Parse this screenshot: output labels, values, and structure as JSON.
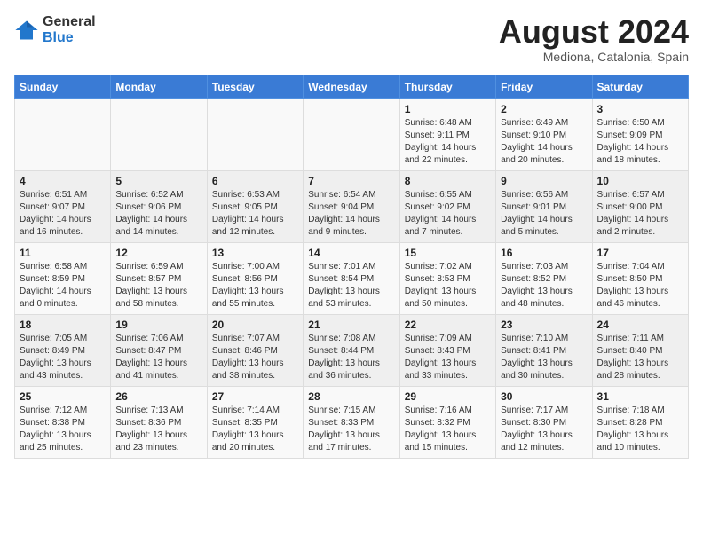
{
  "header": {
    "logo_general": "General",
    "logo_blue": "Blue",
    "month_year": "August 2024",
    "location": "Mediona, Catalonia, Spain"
  },
  "days_of_week": [
    "Sunday",
    "Monday",
    "Tuesday",
    "Wednesday",
    "Thursday",
    "Friday",
    "Saturday"
  ],
  "weeks": [
    [
      {
        "day": "",
        "info": ""
      },
      {
        "day": "",
        "info": ""
      },
      {
        "day": "",
        "info": ""
      },
      {
        "day": "",
        "info": ""
      },
      {
        "day": "1",
        "info": "Sunrise: 6:48 AM\nSunset: 9:11 PM\nDaylight: 14 hours\nand 22 minutes."
      },
      {
        "day": "2",
        "info": "Sunrise: 6:49 AM\nSunset: 9:10 PM\nDaylight: 14 hours\nand 20 minutes."
      },
      {
        "day": "3",
        "info": "Sunrise: 6:50 AM\nSunset: 9:09 PM\nDaylight: 14 hours\nand 18 minutes."
      }
    ],
    [
      {
        "day": "4",
        "info": "Sunrise: 6:51 AM\nSunset: 9:07 PM\nDaylight: 14 hours\nand 16 minutes."
      },
      {
        "day": "5",
        "info": "Sunrise: 6:52 AM\nSunset: 9:06 PM\nDaylight: 14 hours\nand 14 minutes."
      },
      {
        "day": "6",
        "info": "Sunrise: 6:53 AM\nSunset: 9:05 PM\nDaylight: 14 hours\nand 12 minutes."
      },
      {
        "day": "7",
        "info": "Sunrise: 6:54 AM\nSunset: 9:04 PM\nDaylight: 14 hours\nand 9 minutes."
      },
      {
        "day": "8",
        "info": "Sunrise: 6:55 AM\nSunset: 9:02 PM\nDaylight: 14 hours\nand 7 minutes."
      },
      {
        "day": "9",
        "info": "Sunrise: 6:56 AM\nSunset: 9:01 PM\nDaylight: 14 hours\nand 5 minutes."
      },
      {
        "day": "10",
        "info": "Sunrise: 6:57 AM\nSunset: 9:00 PM\nDaylight: 14 hours\nand 2 minutes."
      }
    ],
    [
      {
        "day": "11",
        "info": "Sunrise: 6:58 AM\nSunset: 8:59 PM\nDaylight: 14 hours\nand 0 minutes."
      },
      {
        "day": "12",
        "info": "Sunrise: 6:59 AM\nSunset: 8:57 PM\nDaylight: 13 hours\nand 58 minutes."
      },
      {
        "day": "13",
        "info": "Sunrise: 7:00 AM\nSunset: 8:56 PM\nDaylight: 13 hours\nand 55 minutes."
      },
      {
        "day": "14",
        "info": "Sunrise: 7:01 AM\nSunset: 8:54 PM\nDaylight: 13 hours\nand 53 minutes."
      },
      {
        "day": "15",
        "info": "Sunrise: 7:02 AM\nSunset: 8:53 PM\nDaylight: 13 hours\nand 50 minutes."
      },
      {
        "day": "16",
        "info": "Sunrise: 7:03 AM\nSunset: 8:52 PM\nDaylight: 13 hours\nand 48 minutes."
      },
      {
        "day": "17",
        "info": "Sunrise: 7:04 AM\nSunset: 8:50 PM\nDaylight: 13 hours\nand 46 minutes."
      }
    ],
    [
      {
        "day": "18",
        "info": "Sunrise: 7:05 AM\nSunset: 8:49 PM\nDaylight: 13 hours\nand 43 minutes."
      },
      {
        "day": "19",
        "info": "Sunrise: 7:06 AM\nSunset: 8:47 PM\nDaylight: 13 hours\nand 41 minutes."
      },
      {
        "day": "20",
        "info": "Sunrise: 7:07 AM\nSunset: 8:46 PM\nDaylight: 13 hours\nand 38 minutes."
      },
      {
        "day": "21",
        "info": "Sunrise: 7:08 AM\nSunset: 8:44 PM\nDaylight: 13 hours\nand 36 minutes."
      },
      {
        "day": "22",
        "info": "Sunrise: 7:09 AM\nSunset: 8:43 PM\nDaylight: 13 hours\nand 33 minutes."
      },
      {
        "day": "23",
        "info": "Sunrise: 7:10 AM\nSunset: 8:41 PM\nDaylight: 13 hours\nand 30 minutes."
      },
      {
        "day": "24",
        "info": "Sunrise: 7:11 AM\nSunset: 8:40 PM\nDaylight: 13 hours\nand 28 minutes."
      }
    ],
    [
      {
        "day": "25",
        "info": "Sunrise: 7:12 AM\nSunset: 8:38 PM\nDaylight: 13 hours\nand 25 minutes."
      },
      {
        "day": "26",
        "info": "Sunrise: 7:13 AM\nSunset: 8:36 PM\nDaylight: 13 hours\nand 23 minutes."
      },
      {
        "day": "27",
        "info": "Sunrise: 7:14 AM\nSunset: 8:35 PM\nDaylight: 13 hours\nand 20 minutes."
      },
      {
        "day": "28",
        "info": "Sunrise: 7:15 AM\nSunset: 8:33 PM\nDaylight: 13 hours\nand 17 minutes."
      },
      {
        "day": "29",
        "info": "Sunrise: 7:16 AM\nSunset: 8:32 PM\nDaylight: 13 hours\nand 15 minutes."
      },
      {
        "day": "30",
        "info": "Sunrise: 7:17 AM\nSunset: 8:30 PM\nDaylight: 13 hours\nand 12 minutes."
      },
      {
        "day": "31",
        "info": "Sunrise: 7:18 AM\nSunset: 8:28 PM\nDaylight: 13 hours\nand 10 minutes."
      }
    ]
  ]
}
